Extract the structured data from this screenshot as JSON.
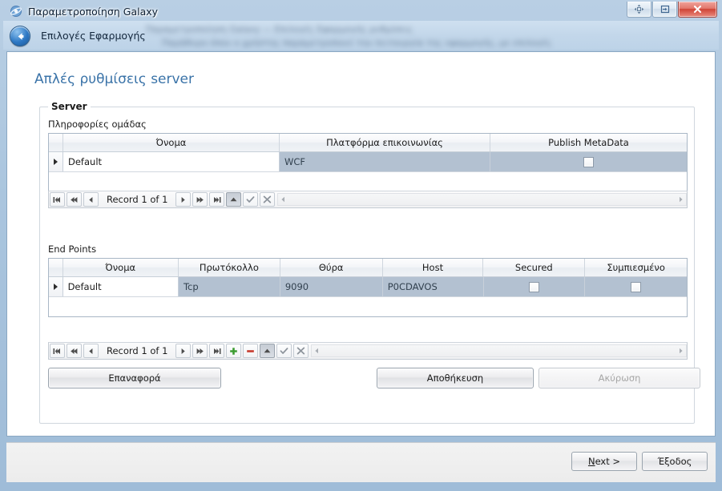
{
  "window": {
    "title": "Παραμετροποίηση Galaxy",
    "app_icon": "galaxy-app-icon",
    "buttons": {
      "move": "move-icon",
      "restore_down": "minimize-to-tray-icon",
      "close": "✕"
    }
  },
  "header": {
    "back_icon": "back-arrow-icon",
    "back_label": "Επιλογές Εφαρμογής",
    "blurred_line_1": "Παραμετροποίηση Galaxy — Επιλογές Εφαρμογής ρυθμίσεις",
    "blurred_line_2": "Παράθυρο όπου ο χρήστης παραμετροποιεί την λειτουργία της εφαρμογής, με επιλογές"
  },
  "page": {
    "title": "Απλές ρυθμίσεις server",
    "groupbox_title": "Server"
  },
  "group_info": {
    "label": "Πληροφορίες ομάδας",
    "columns": [
      "Όνομα",
      "Πλατφόρμα επικοινωνίας",
      "Publish MetaData"
    ],
    "rows": [
      {
        "name": "Default",
        "platform": "WCF",
        "publish_metadata": false,
        "selected": true
      }
    ],
    "navigator": {
      "first": "first-record-icon",
      "prev_page": "previous-page-icon",
      "prev": "previous-record-icon",
      "record_text": "Record 1 of 1",
      "next": "next-record-icon",
      "next_page": "next-page-icon",
      "last": "last-record-icon",
      "up": "move-up-icon",
      "accept": "accept-icon",
      "cancel": "cancel-icon"
    }
  },
  "end_points": {
    "label": "End Points",
    "columns": [
      "Όνομα",
      "Πρωτόκολλο",
      "Θύρα",
      "Host",
      "Secured",
      "Συμπιεσμένο"
    ],
    "rows": [
      {
        "name": "Default",
        "protocol": "Tcp",
        "port": "9090",
        "host": "P0CDAVOS",
        "secured": false,
        "compressed": false,
        "selected": true
      }
    ],
    "navigator": {
      "first": "first-record-icon",
      "prev_page": "previous-page-icon",
      "prev": "previous-record-icon",
      "record_text": "Record 1 of 1",
      "next": "next-record-icon",
      "next_page": "next-page-icon",
      "last": "last-record-icon",
      "add": "add-record-icon",
      "delete": "delete-record-icon",
      "up": "move-up-icon",
      "accept": "accept-icon",
      "cancel": "cancel-icon"
    }
  },
  "actions": {
    "restore": "Επαναφορά",
    "save": "Αποθήκευση",
    "cancel": "Ακύρωση",
    "cancel_enabled": false
  },
  "footer": {
    "next": "Next >",
    "next_accel": "N",
    "next_rest": "ext >",
    "exit": "Έξοδος"
  },
  "colors": {
    "accent_title": "#3a73a8",
    "selected_row": "#b3c1d1",
    "close_button": "#cf4436",
    "add_button": "#3c9c32",
    "delete_button": "#c63a2e"
  }
}
